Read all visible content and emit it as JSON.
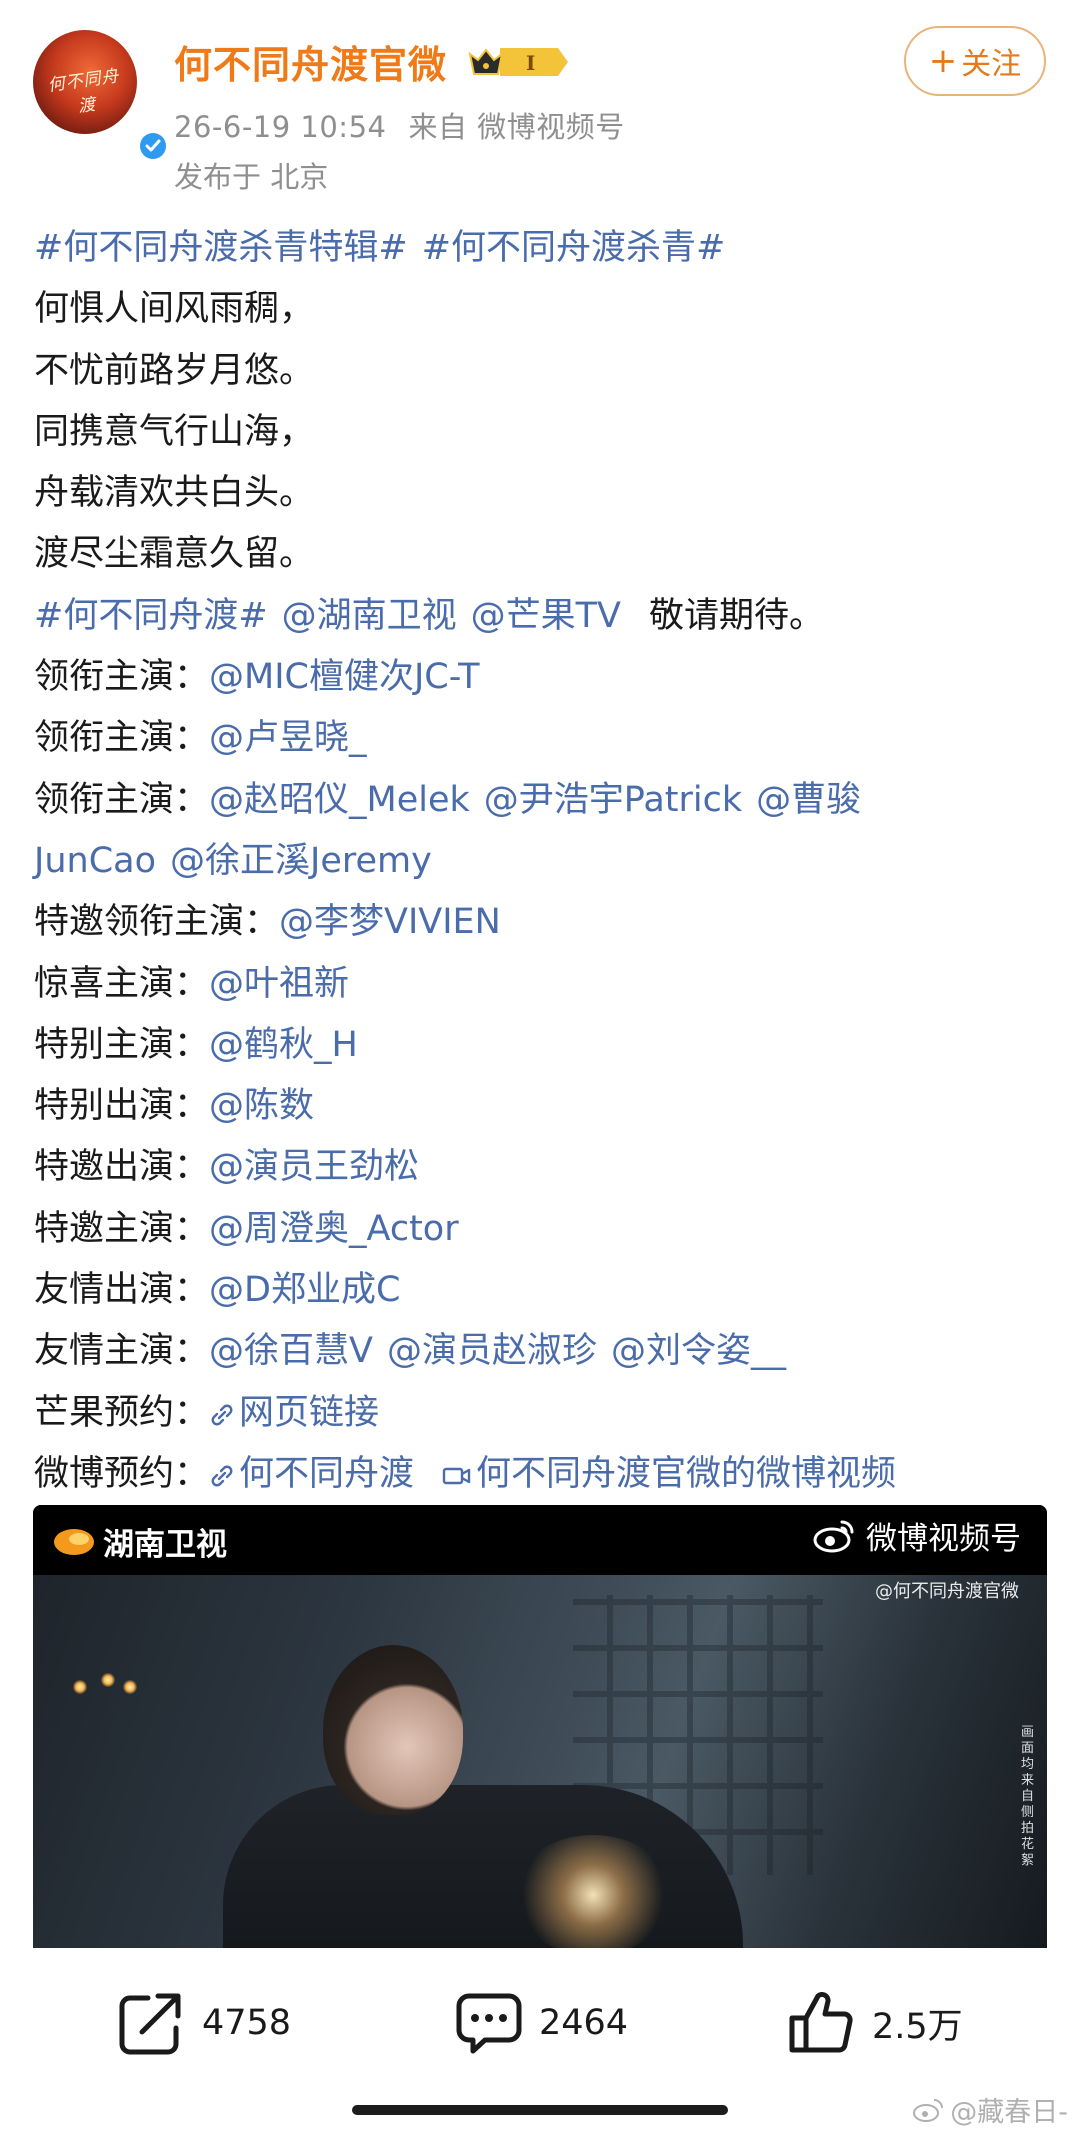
{
  "author": {
    "name": "何不同舟渡官微",
    "avatar_text": "何不同舟渡",
    "rank_level": "I",
    "timestamp": "26-6-19 10:54",
    "source": "来自 微博视频号",
    "location": "发布于 北京",
    "follow_label": "关注"
  },
  "post": {
    "tags_line": [
      "#何不同舟渡杀青特辑#",
      "#何不同舟渡杀青#"
    ],
    "poem": [
      "何惧人间风雨稠，",
      "不忧前路岁月悠。",
      "同携意气行山海，",
      "舟载清欢共白头。",
      "渡尽尘霜意久留。"
    ],
    "promo": {
      "tag": "#何不同舟渡#",
      "mention1": "@湖南卫视",
      "mention2": "@芒果TV",
      "text": "敬请期待。"
    },
    "cast": [
      {
        "role": "领衔主演：",
        "names": [
          "@MIC檀健次JC-T"
        ]
      },
      {
        "role": "领衔主演：",
        "names": [
          "@卢昱晓_"
        ]
      },
      {
        "role": "领衔主演：",
        "names": [
          "@赵昭仪_Melek",
          "@尹浩宇Patrick",
          "@曹骏"
        ]
      },
      {
        "role": "",
        "names": [
          "JunCao",
          "@徐正溪Jeremy"
        ]
      },
      {
        "role": "特邀领衔主演：",
        "names": [
          "@李梦VIVIEN"
        ]
      },
      {
        "role": "惊喜主演：",
        "names": [
          "@叶祖新"
        ]
      },
      {
        "role": "特别主演：",
        "names": [
          "@鹤秋_H"
        ]
      },
      {
        "role": "特别出演：",
        "names": [
          "@陈数"
        ]
      },
      {
        "role": "特邀出演：",
        "names": [
          "@演员王劲松"
        ]
      },
      {
        "role": "特邀主演：",
        "names": [
          "@周澄奥_Actor"
        ]
      },
      {
        "role": "友情出演：",
        "names": [
          "@D郑业成C"
        ]
      },
      {
        "role": "友情主演：",
        "names": [
          "@徐百慧V",
          "@演员赵淑珍",
          "@刘令姿__"
        ]
      }
    ],
    "mango_reserve": {
      "label": "芒果预约：",
      "link": "网页链接"
    },
    "weibo_reserve": {
      "label": "微博预约：",
      "link": "何不同舟渡",
      "video_link": "何不同舟渡官微的微博视频"
    }
  },
  "video": {
    "station": "湖南卫视",
    "platform": "微博视频号",
    "handle": "@何不同舟渡官微",
    "side_note": "画面均来自侧拍花絮"
  },
  "actions": {
    "repost_count": "4758",
    "comment_count": "2464",
    "like_count": "2.5万"
  },
  "watermark": "@藏春日-",
  "colors": {
    "link": "#4a6cab",
    "username": "#ef7a17",
    "follow_border": "#e9b47a"
  }
}
